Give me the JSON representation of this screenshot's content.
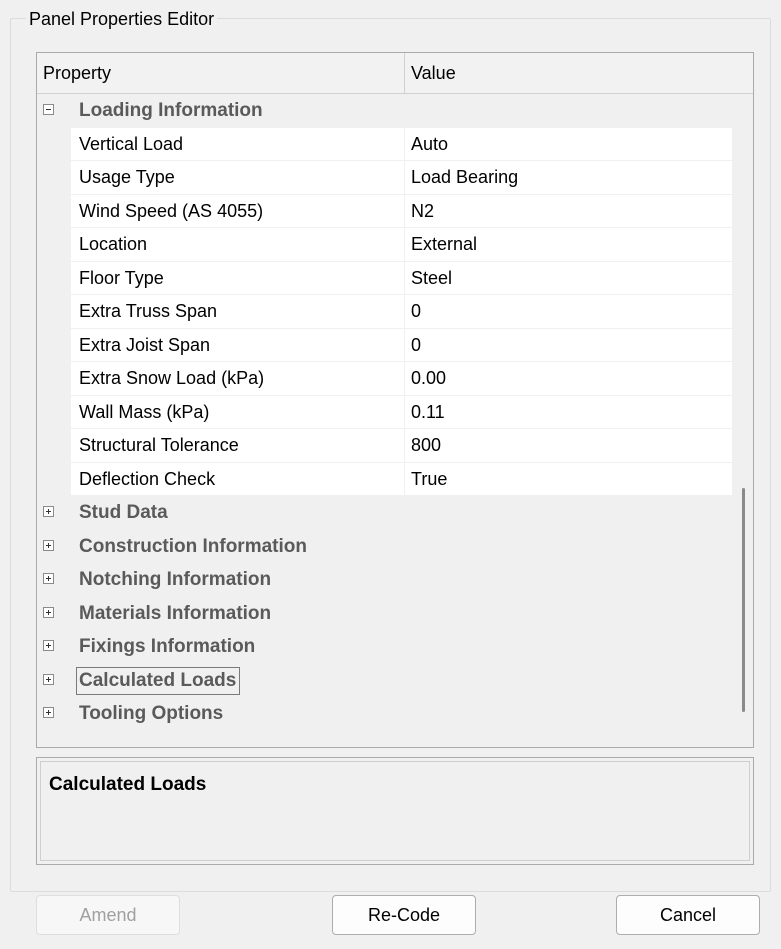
{
  "window": {
    "group_title": "Panel Properties Editor"
  },
  "grid": {
    "header": {
      "property": "Property",
      "value": "Value"
    },
    "category_loading": {
      "label": "Loading Information",
      "expanded": true,
      "properties": [
        {
          "name": "Vertical Load",
          "value": "Auto"
        },
        {
          "name": "Usage Type",
          "value": "Load Bearing"
        },
        {
          "name": "Wind Speed (AS 4055)",
          "value": "N2"
        },
        {
          "name": "Location",
          "value": "External"
        },
        {
          "name": "Floor Type",
          "value": "Steel"
        },
        {
          "name": "Extra Truss Span",
          "value": "0"
        },
        {
          "name": "Extra Joist Span",
          "value": "0"
        },
        {
          "name": "Extra Snow Load (kPa)",
          "value": "0.00"
        },
        {
          "name": "Wall Mass (kPa)",
          "value": "0.11"
        },
        {
          "name": "Structural Tolerance",
          "value": "800"
        },
        {
          "name": "Deflection Check",
          "value": "True"
        }
      ]
    },
    "collapsed_categories": [
      {
        "label": "Stud Data"
      },
      {
        "label": "Construction Information"
      },
      {
        "label": "Notching Information"
      },
      {
        "label": "Materials Information"
      },
      {
        "label": "Fixings Information"
      },
      {
        "label": "Calculated Loads",
        "selected": true
      },
      {
        "label": "Tooling Options"
      }
    ]
  },
  "description": {
    "title": "Calculated Loads"
  },
  "buttons": {
    "amend": "Amend",
    "recode": "Re-Code",
    "cancel": "Cancel"
  }
}
